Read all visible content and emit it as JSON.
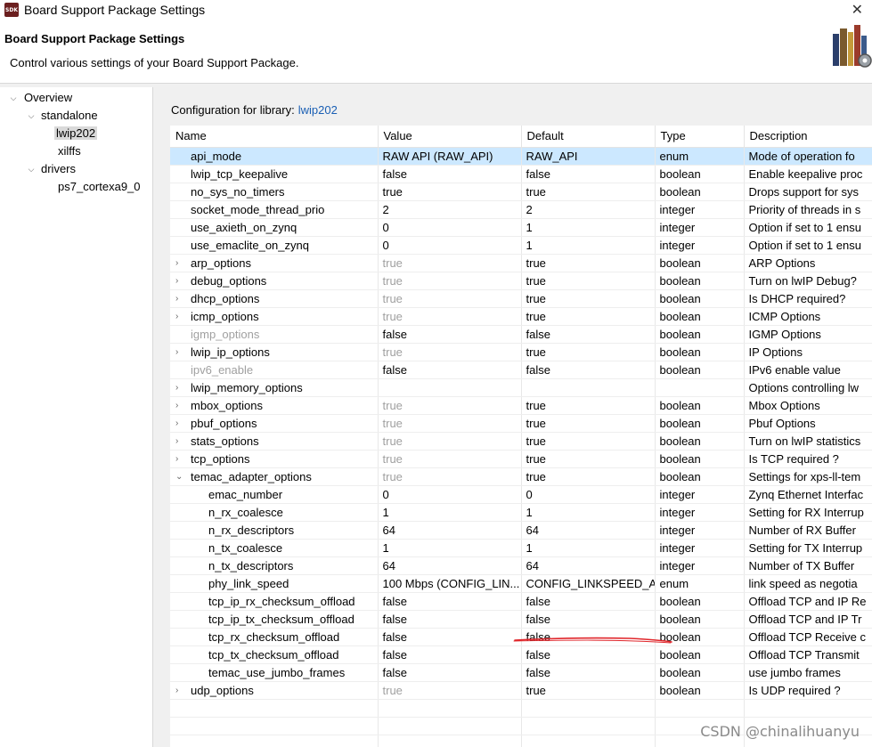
{
  "window": {
    "icon_text": "SDK",
    "title": "Board Support Package Settings",
    "close_glyph": "✕"
  },
  "header": {
    "heading": "Board Support Package Settings",
    "subtitle": "Control various settings of your Board Support Package."
  },
  "tree": {
    "items": [
      {
        "label": "Overview",
        "expanded": true
      },
      {
        "label": "standalone",
        "expanded": true
      },
      {
        "label": "lwip202",
        "selected": true
      },
      {
        "label": "xilffs"
      },
      {
        "label": "drivers",
        "expanded": true
      },
      {
        "label": "ps7_cortexa9_0"
      }
    ]
  },
  "config": {
    "label": "Configuration for library:",
    "library": "lwip202"
  },
  "table": {
    "headers": [
      "Name",
      "Value",
      "Default",
      "Type",
      "Description"
    ],
    "rows": [
      {
        "name": "api_mode",
        "value": "RAW API (RAW_API)",
        "default": "RAW_API",
        "type": "enum",
        "desc": "Mode of operation fo",
        "level": 0,
        "selected": true
      },
      {
        "name": "lwip_tcp_keepalive",
        "value": "false",
        "default": "false",
        "type": "boolean",
        "desc": "Enable keepalive proc",
        "level": 0
      },
      {
        "name": "no_sys_no_timers",
        "value": "true",
        "default": "true",
        "type": "boolean",
        "desc": "Drops support for sys",
        "level": 0
      },
      {
        "name": "socket_mode_thread_prio",
        "value": "2",
        "default": "2",
        "type": "integer",
        "desc": "Priority of threads in s",
        "level": 0
      },
      {
        "name": "use_axieth_on_zynq",
        "value": "0",
        "default": "1",
        "type": "integer",
        "desc": "Option if set to 1 ensu",
        "level": 0
      },
      {
        "name": "use_emaclite_on_zynq",
        "value": "0",
        "default": "1",
        "type": "integer",
        "desc": "Option if set to 1 ensu",
        "level": 0
      },
      {
        "name": "arp_options",
        "value": "true",
        "default": "true",
        "type": "boolean",
        "desc": "ARP Options",
        "level": 0,
        "expander": "›",
        "value_muted": true
      },
      {
        "name": "debug_options",
        "value": "true",
        "default": "true",
        "type": "boolean",
        "desc": "Turn on lwIP Debug?",
        "level": 0,
        "expander": "›",
        "value_muted": true
      },
      {
        "name": "dhcp_options",
        "value": "true",
        "default": "true",
        "type": "boolean",
        "desc": "Is DHCP required?",
        "level": 0,
        "expander": "›",
        "value_muted": true
      },
      {
        "name": "icmp_options",
        "value": "true",
        "default": "true",
        "type": "boolean",
        "desc": "ICMP Options",
        "level": 0,
        "expander": "›",
        "value_muted": true
      },
      {
        "name": "igmp_options",
        "value": "false",
        "default": "false",
        "type": "boolean",
        "desc": "IGMP Options",
        "level": 0,
        "name_muted": true
      },
      {
        "name": "lwip_ip_options",
        "value": "true",
        "default": "true",
        "type": "boolean",
        "desc": "IP Options",
        "level": 0,
        "expander": "›",
        "value_muted": true
      },
      {
        "name": "ipv6_enable",
        "value": "false",
        "default": "false",
        "type": "boolean",
        "desc": "IPv6 enable value",
        "level": 0,
        "name_muted": true
      },
      {
        "name": "lwip_memory_options",
        "value": "",
        "default": "",
        "type": "",
        "desc": "Options controlling lw",
        "level": 0,
        "expander": "›"
      },
      {
        "name": "mbox_options",
        "value": "true",
        "default": "true",
        "type": "boolean",
        "desc": "Mbox Options",
        "level": 0,
        "expander": "›",
        "value_muted": true
      },
      {
        "name": "pbuf_options",
        "value": "true",
        "default": "true",
        "type": "boolean",
        "desc": "Pbuf Options",
        "level": 0,
        "expander": "›",
        "value_muted": true
      },
      {
        "name": "stats_options",
        "value": "true",
        "default": "true",
        "type": "boolean",
        "desc": "Turn on lwIP statistics",
        "level": 0,
        "expander": "›",
        "value_muted": true
      },
      {
        "name": "tcp_options",
        "value": "true",
        "default": "true",
        "type": "boolean",
        "desc": "Is TCP required ?",
        "level": 0,
        "expander": "›",
        "value_muted": true
      },
      {
        "name": "temac_adapter_options",
        "value": "true",
        "default": "true",
        "type": "boolean",
        "desc": "Settings for xps-ll-tem",
        "level": 0,
        "expander": "⌄",
        "value_muted": true
      },
      {
        "name": "emac_number",
        "value": "0",
        "default": "0",
        "type": "integer",
        "desc": "Zynq Ethernet Interfac",
        "level": 1
      },
      {
        "name": "n_rx_coalesce",
        "value": "1",
        "default": "1",
        "type": "integer",
        "desc": "Setting for RX Interrup",
        "level": 1
      },
      {
        "name": "n_rx_descriptors",
        "value": "64",
        "default": "64",
        "type": "integer",
        "desc": "Number of RX Buffer",
        "level": 1
      },
      {
        "name": "n_tx_coalesce",
        "value": "1",
        "default": "1",
        "type": "integer",
        "desc": "Setting for TX Interrup",
        "level": 1
      },
      {
        "name": "n_tx_descriptors",
        "value": "64",
        "default": "64",
        "type": "integer",
        "desc": "Number of TX Buffer",
        "level": 1
      },
      {
        "name": "phy_link_speed",
        "value": "100 Mbps (CONFIG_LIN...",
        "default": "CONFIG_LINKSPEED_A...",
        "type": "enum",
        "desc": "link speed as negotia",
        "level": 1
      },
      {
        "name": "tcp_ip_rx_checksum_offload",
        "value": "false",
        "default": "false",
        "type": "boolean",
        "desc": "Offload TCP and IP Re",
        "level": 1
      },
      {
        "name": "tcp_ip_tx_checksum_offload",
        "value": "false",
        "default": "false",
        "type": "boolean",
        "desc": "Offload TCP and IP Tr",
        "level": 1
      },
      {
        "name": "tcp_rx_checksum_offload",
        "value": "false",
        "default": "false",
        "type": "boolean",
        "desc": "Offload TCP Receive c",
        "level": 1
      },
      {
        "name": "tcp_tx_checksum_offload",
        "value": "false",
        "default": "false",
        "type": "boolean",
        "desc": "Offload TCP Transmit",
        "level": 1
      },
      {
        "name": "temac_use_jumbo_frames",
        "value": "false",
        "default": "false",
        "type": "boolean",
        "desc": "use jumbo frames",
        "level": 1
      },
      {
        "name": "udp_options",
        "value": "true",
        "default": "true",
        "type": "boolean",
        "desc": "Is UDP required ?",
        "level": 0,
        "expander": "›",
        "value_muted": true
      }
    ]
  },
  "watermark": "CSDN @chinalihuanyu",
  "colors": {
    "selection": "#cce8ff",
    "link": "#1a5fb4",
    "annotation": "#e0262b"
  }
}
